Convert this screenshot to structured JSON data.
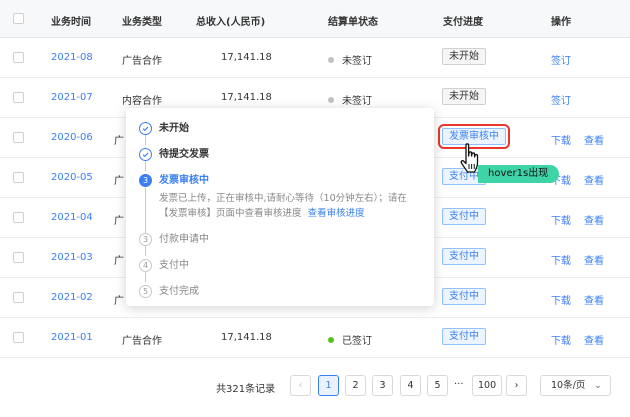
{
  "header": {
    "date": "业务时间",
    "type": "业务类型",
    "income": "总收入(人民币)",
    "statement": "结算单状态",
    "progress": "支付进度",
    "ops": "操作"
  },
  "rows": [
    {
      "date": "2021-08",
      "type": "广告合作",
      "income": "17,141.18",
      "status": "未签订",
      "status_color": "#c0c0c0",
      "progress": "未开始",
      "ops": [
        "签订"
      ]
    },
    {
      "date": "2021-07",
      "type": "内容合作",
      "income": "17,141.18",
      "status": "未签订",
      "status_color": "#c0c0c0",
      "progress": "未开始",
      "ops": [
        "签订"
      ]
    },
    {
      "date": "2020-06",
      "type": "广",
      "income": "",
      "status": "",
      "status_color": "",
      "progress": "发票审核中",
      "ops": [
        "下载",
        "查看"
      ]
    },
    {
      "date": "2020-05",
      "type": "广",
      "income": "",
      "status": "",
      "status_color": "",
      "progress": "支付中",
      "ops": [
        "下载",
        "查看"
      ]
    },
    {
      "date": "2021-04",
      "type": "广",
      "income": "",
      "status": "",
      "status_color": "",
      "progress": "支付中",
      "ops": [
        "下载",
        "查看"
      ]
    },
    {
      "date": "2021-03",
      "type": "广",
      "income": "",
      "status": "",
      "status_color": "",
      "progress": "支付中",
      "ops": [
        "下载",
        "查看"
      ]
    },
    {
      "date": "2021-02",
      "type": "广",
      "income": "",
      "status": "",
      "status_color": "",
      "progress": "支付中",
      "ops": [
        "下载",
        "查看"
      ]
    },
    {
      "date": "2021-01",
      "type": "广告合作",
      "income": "17,141.18",
      "status": "已签订",
      "status_color": "#52c41a",
      "progress": "支付中",
      "ops": [
        "下载",
        "查看"
      ]
    }
  ],
  "popover": {
    "steps": [
      {
        "icon": "check-circle-icon",
        "num": "",
        "label": "未开始",
        "state": "done"
      },
      {
        "icon": "check-circle-icon",
        "num": "",
        "label": "待提交发票",
        "state": "done"
      },
      {
        "icon": "",
        "num": "3",
        "label": "发票审核中",
        "state": "active"
      },
      {
        "icon": "",
        "num": "3",
        "label": "付款申请中",
        "state": "pending"
      },
      {
        "icon": "",
        "num": "4",
        "label": "支付中",
        "state": "pending"
      },
      {
        "icon": "",
        "num": "5",
        "label": "支付完成",
        "state": "pending"
      }
    ],
    "desc_line1": "发票已上传，正在审核中,请耐心等待（10分钟左右）；请在",
    "desc_line2": "【发票审核】页面中查看审核进度",
    "desc_link": "查看审核进度"
  },
  "annotation": {
    "hover_badge": "hover1s出现",
    "cursor_icon": "hand-pointer-icon"
  },
  "pagination": {
    "total": "共321条记录",
    "pages": [
      "1",
      "2",
      "3",
      "4",
      "5"
    ],
    "ellipsis": "···",
    "last_page": "100",
    "active_page": "1",
    "page_size": "10条/页",
    "prev_icon": "chevron-left-icon",
    "next_icon": "chevron-right-icon",
    "size_icon": "chevron-down-icon"
  },
  "colors": {
    "accent": "#3b7ff0",
    "highlight_border": "#e8372a",
    "badge_green": "#3fd3a8",
    "signed_dot": "#52c41a",
    "unsigned_dot": "#c0c0c0"
  }
}
